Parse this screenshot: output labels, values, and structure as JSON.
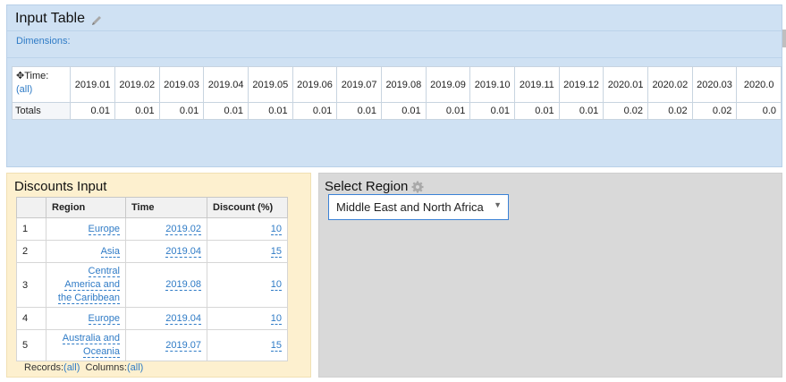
{
  "input_table": {
    "title": "Input Table",
    "dimensions_label": "Dimensions:",
    "time_label": "Time:",
    "time_filter": "(all)",
    "columns": [
      "2019.01",
      "2019.02",
      "2019.03",
      "2019.04",
      "2019.05",
      "2019.06",
      "2019.07",
      "2019.08",
      "2019.09",
      "2019.10",
      "2019.11",
      "2019.12",
      "2020.01",
      "2020.02",
      "2020.03",
      "2020.0"
    ],
    "totals_label": "Totals",
    "totals": [
      "0.01",
      "0.01",
      "0.01",
      "0.01",
      "0.01",
      "0.01",
      "0.01",
      "0.01",
      "0.01",
      "0.01",
      "0.01",
      "0.01",
      "0.02",
      "0.02",
      "0.02",
      "0.0"
    ]
  },
  "discounts": {
    "title": "Discounts Input",
    "headers": [
      "",
      "Region",
      "Time",
      "Discount (%)"
    ],
    "rows": [
      {
        "n": "1",
        "region": "Europe",
        "time": "2019.02",
        "discount": "10"
      },
      {
        "n": "2",
        "region": "Asia",
        "time": "2019.04",
        "discount": "15"
      },
      {
        "n": "3",
        "region": "Central America and the Caribbean",
        "time": "2019.08",
        "discount": "10"
      },
      {
        "n": "4",
        "region": "Europe",
        "time": "2019.04",
        "discount": "10"
      },
      {
        "n": "5",
        "region": "Australia and Oceania",
        "time": "2019.07",
        "discount": "15"
      }
    ],
    "footer_records_label": "Records:",
    "footer_records_value": "(all)",
    "footer_columns_label": "Columns:",
    "footer_columns_value": "(all)"
  },
  "region": {
    "title": "Select Region",
    "selected": "Middle East and North Africa",
    "arrow": "▼"
  }
}
